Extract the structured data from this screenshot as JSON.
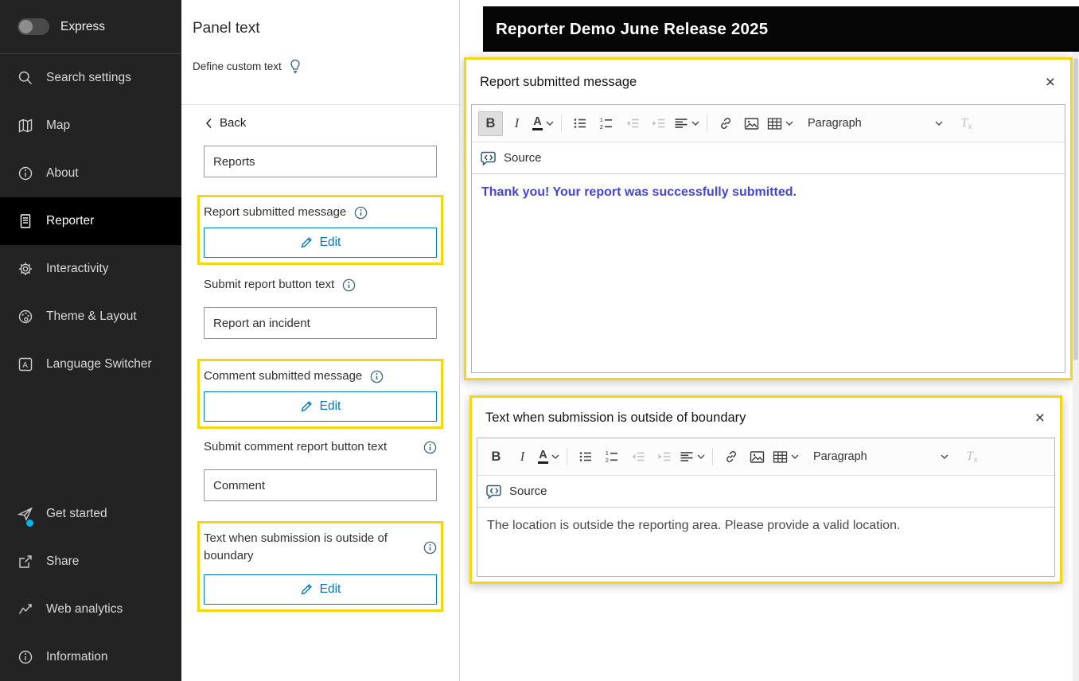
{
  "sidebar": {
    "express_label": "Express",
    "items": [
      {
        "label": "Search settings",
        "icon": "search-icon",
        "active": false
      },
      {
        "label": "Map",
        "icon": "map-icon",
        "active": false
      },
      {
        "label": "About",
        "icon": "info-icon",
        "active": false
      },
      {
        "label": "Reporter",
        "icon": "report-document-icon",
        "active": true
      },
      {
        "label": "Interactivity",
        "icon": "gear-icon",
        "active": false
      },
      {
        "label": "Theme & Layout",
        "icon": "palette-icon",
        "active": false
      },
      {
        "label": "Language Switcher",
        "icon": "language-icon",
        "active": false
      }
    ],
    "footer_items": [
      {
        "label": "Get started",
        "icon": "paper-plane-icon",
        "badge": true
      },
      {
        "label": "Share",
        "icon": "share-icon",
        "badge": false
      },
      {
        "label": "Web analytics",
        "icon": "line-chart-icon",
        "badge": false
      },
      {
        "label": "Information",
        "icon": "info-icon",
        "badge": false
      }
    ]
  },
  "panel": {
    "title": "Panel text",
    "subtitle": "Define custom text",
    "back_label": "Back",
    "top_input_value": "Reports",
    "fields": [
      {
        "kind": "edit",
        "label": "Report submitted message",
        "button_label": "Edit",
        "highlighted": true
      },
      {
        "kind": "input",
        "label": "Submit report button text",
        "value": "Report an incident"
      },
      {
        "kind": "edit",
        "label": "Comment submitted message",
        "button_label": "Edit",
        "highlighted": true
      },
      {
        "kind": "input",
        "label": "Submit comment report button text",
        "value": "Comment"
      },
      {
        "kind": "edit",
        "label": "Text when submission is outside of boundary",
        "button_label": "Edit",
        "highlighted": true
      }
    ]
  },
  "stage": {
    "header_title": "Reporter Demo June Release 2025"
  },
  "dialogs": [
    {
      "title": "Report submitted message",
      "content": "Thank you! Your report was successfully submitted.",
      "content_bold": true,
      "content_color": "#4545d1"
    },
    {
      "title": "Text when submission is outside of boundary",
      "content": "The location is outside the reporting area. Please provide a valid location.",
      "content_bold": false,
      "content_color": "#4a4a4a"
    }
  ],
  "editor": {
    "bold_label": "B",
    "italic_label": "I",
    "font_color_label": "A",
    "paragraph_label": "Paragraph",
    "source_label": "Source",
    "clear_format_label": "T",
    "clear_format_sub": "x",
    "close_glyph": "×"
  },
  "colors": {
    "accent_blue": "#0079c1",
    "highlight_yellow": "#f4d612",
    "message_blue": "#4545d1",
    "sidebar_bg": "#232323",
    "active_item_bg": "#000000",
    "header_bg": "#060606",
    "badge_blue": "#00b4f1"
  }
}
